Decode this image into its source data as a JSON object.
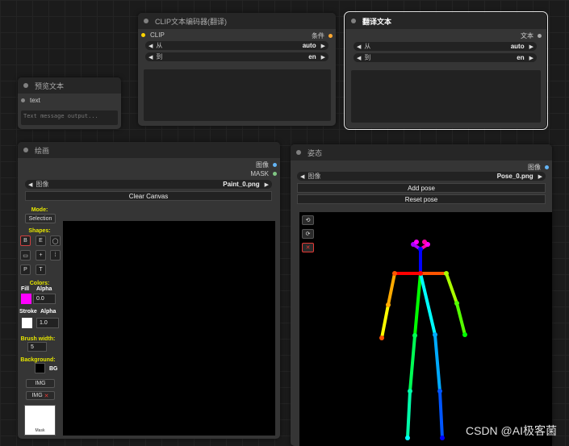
{
  "preview_node": {
    "title": "预览文本",
    "input_label": "text",
    "placeholder": "Text message output..."
  },
  "clip_node": {
    "title": "CLIP文本编码器(翻译)",
    "input_label": "CLIP",
    "output_label": "条件",
    "from_label": "从",
    "from_value": "auto",
    "to_label": "到",
    "to_value": "en"
  },
  "translate_node": {
    "title": "翻译文本",
    "output_label": "文本",
    "from_label": "从",
    "from_value": "auto",
    "to_label": "到",
    "to_value": "en"
  },
  "paint_node": {
    "title": "绘画",
    "output_image": "图像",
    "output_mask": "MASK",
    "image_label": "图像",
    "image_value": "Paint_0.png",
    "clear_button": "Clear Canvas",
    "mode_label": "Mode:",
    "mode_button": "Selection",
    "shapes_label": "Shapes:",
    "tools": [
      "B",
      "E",
      "◯",
      "▭",
      "+",
      "⁞",
      "P",
      "T"
    ],
    "colors_label": "Colors:",
    "fill_label": "Fill",
    "alpha_label": "Alpha",
    "fill_alpha": "0.0",
    "stroke_label": "Stroke",
    "stroke_alpha": "1.0",
    "brush_label": "Brush width:",
    "brush_value": "5",
    "background_label": "Background:",
    "bg_text": "BG",
    "img_button": "IMG",
    "img_remove_button": "IMG",
    "mask_text": "Mask",
    "fill_color": "#ff00ff",
    "stroke_color": "#ffffff"
  },
  "pose_node": {
    "title": "姿态",
    "output_image": "图像",
    "image_label": "图像",
    "image_value": "Pose_0.png",
    "add_button": "Add pose",
    "reset_button": "Reset pose",
    "undo_icon": "undo-icon",
    "redo_icon": "redo-icon",
    "delete_icon": "close-icon"
  },
  "watermark": "CSDN @AI极客菌"
}
